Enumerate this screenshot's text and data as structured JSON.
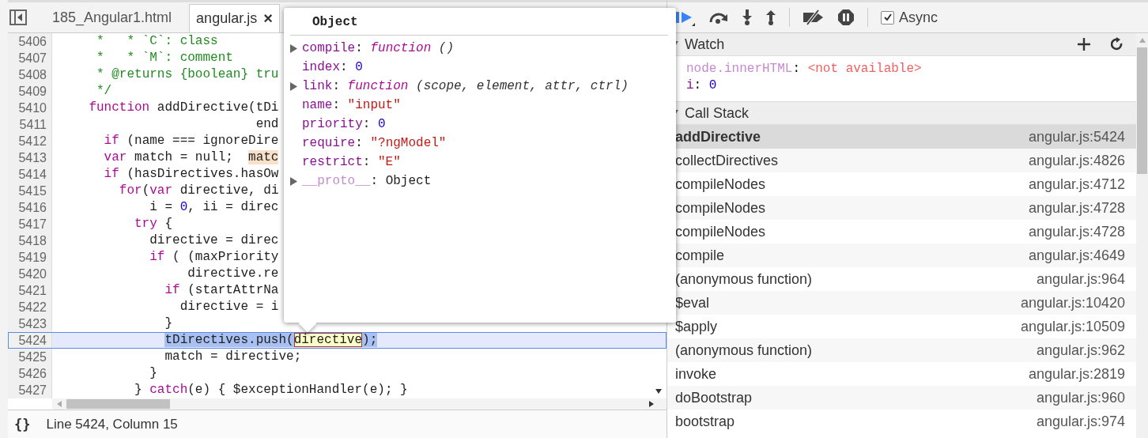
{
  "tabs": [
    {
      "label": "185_Angular1.html",
      "selected": false
    },
    {
      "label": "angular.js",
      "selected": true,
      "close": "×"
    }
  ],
  "code_lines": [
    {
      "number": "5406",
      "current": false,
      "segments": [
        {
          "kind": "comment",
          "text": "     *   * `C`: class"
        }
      ]
    },
    {
      "number": "5407",
      "current": false,
      "segments": [
        {
          "kind": "comment",
          "text": "     *   * `M`: comment"
        }
      ]
    },
    {
      "number": "5408",
      "current": false,
      "segments": [
        {
          "kind": "comment",
          "text": "     * @returns {boolean} tru"
        }
      ]
    },
    {
      "number": "5409",
      "current": false,
      "segments": [
        {
          "kind": "comment",
          "text": "     */"
        }
      ]
    },
    {
      "number": "5410",
      "current": false,
      "segments": [
        {
          "kind": "keyword",
          "text": "    function"
        },
        {
          "kind": "plain",
          "text": " addDirective(tDi"
        }
      ]
    },
    {
      "number": "5411",
      "current": false,
      "segments": [
        {
          "kind": "plain",
          "text": "                          end"
        }
      ]
    },
    {
      "number": "5412",
      "current": false,
      "segments": [
        {
          "kind": "keyword",
          "text": "      if"
        },
        {
          "kind": "plain",
          "text": " (name === ignoreDire"
        }
      ]
    },
    {
      "number": "5413",
      "current": false,
      "segments": [
        {
          "kind": "keyword",
          "text": "      var"
        },
        {
          "kind": "plain",
          "text": " match = null;  "
        },
        {
          "kind": "highlight",
          "text": "matc"
        }
      ]
    },
    {
      "number": "5414",
      "current": false,
      "segments": [
        {
          "kind": "keyword",
          "text": "      if"
        },
        {
          "kind": "plain",
          "text": " (hasDirectives.hasOw"
        }
      ]
    },
    {
      "number": "5415",
      "current": false,
      "segments": [
        {
          "kind": "keyword",
          "text": "        for"
        },
        {
          "kind": "plain",
          "text": "("
        },
        {
          "kind": "keyword",
          "text": "var"
        },
        {
          "kind": "plain",
          "text": " directive, di"
        }
      ]
    },
    {
      "number": "5416",
      "current": false,
      "segments": [
        {
          "kind": "plain",
          "text": "            i = "
        },
        {
          "kind": "number",
          "text": "0"
        },
        {
          "kind": "plain",
          "text": ", ii = direc"
        }
      ]
    },
    {
      "number": "5417",
      "current": false,
      "segments": [
        {
          "kind": "keyword",
          "text": "          try"
        },
        {
          "kind": "plain",
          "text": " {"
        }
      ]
    },
    {
      "number": "5418",
      "current": false,
      "segments": [
        {
          "kind": "plain",
          "text": "            directive = direc"
        }
      ]
    },
    {
      "number": "5419",
      "current": false,
      "segments": [
        {
          "kind": "keyword",
          "text": "            if"
        },
        {
          "kind": "plain",
          "text": " ( (maxPriority"
        }
      ]
    },
    {
      "number": "5420",
      "current": false,
      "segments": [
        {
          "kind": "plain",
          "text": "                 directive.re"
        }
      ]
    },
    {
      "number": "5421",
      "current": false,
      "segments": [
        {
          "kind": "keyword",
          "text": "              if"
        },
        {
          "kind": "plain",
          "text": " (startAttrNa"
        }
      ]
    },
    {
      "number": "5422",
      "current": false,
      "segments": [
        {
          "kind": "plain",
          "text": "                directive = i"
        }
      ]
    },
    {
      "number": "5423",
      "current": false,
      "segments": [
        {
          "kind": "plain",
          "text": "              }"
        }
      ]
    },
    {
      "number": "5424",
      "current": true,
      "segments": [
        {
          "kind": "selection",
          "text": "              tDirectives.push("
        },
        {
          "kind": "hover",
          "text": "directive"
        },
        {
          "kind": "selection",
          "text": ");"
        }
      ]
    },
    {
      "number": "5425",
      "current": false,
      "segments": [
        {
          "kind": "plain",
          "text": "              match = directive;"
        }
      ]
    },
    {
      "number": "5426",
      "current": false,
      "segments": [
        {
          "kind": "plain",
          "text": "            }"
        }
      ]
    },
    {
      "number": "5427",
      "current": false,
      "segments": [
        {
          "kind": "plain",
          "text": "          } "
        },
        {
          "kind": "keyword",
          "text": "catch"
        },
        {
          "kind": "plain",
          "text": "(e) { $exceptionHandler(e); }"
        }
      ]
    }
  ],
  "status_bar": {
    "format_button": "{}",
    "position": "Line 5424, Column 15"
  },
  "popover": {
    "title": "Object",
    "separator": ":",
    "properties": [
      {
        "name": "compile",
        "kind": "function",
        "keyword": "function",
        "params": "()",
        "expandable": true,
        "internal": false
      },
      {
        "name": "index",
        "kind": "number",
        "value": "0",
        "expandable": false,
        "internal": false
      },
      {
        "name": "link",
        "kind": "function",
        "keyword": "function",
        "params": "(scope, element, attr, ctrl)",
        "expandable": true,
        "internal": false
      },
      {
        "name": "name",
        "kind": "string",
        "value": "\"input\"",
        "expandable": false,
        "internal": false
      },
      {
        "name": "priority",
        "kind": "number",
        "value": "0",
        "expandable": false,
        "internal": false
      },
      {
        "name": "require",
        "kind": "string",
        "value": "\"?ngModel\"",
        "expandable": false,
        "internal": false
      },
      {
        "name": "restrict",
        "kind": "string",
        "value": "\"E\"",
        "expandable": false,
        "internal": false
      },
      {
        "name": "__proto__",
        "kind": "object",
        "value": "Object",
        "expandable": true,
        "internal": true
      }
    ]
  },
  "debugger_toolbar": {
    "buttons": [
      {
        "kind": "resume"
      },
      {
        "kind": "step-over"
      },
      {
        "kind": "step-into"
      },
      {
        "kind": "step-out"
      },
      {
        "kind": "deactivate-breakpoints"
      },
      {
        "kind": "pause-exceptions"
      }
    ],
    "async": {
      "label": "Async",
      "checked": true
    }
  },
  "watch": {
    "title": "Watch",
    "expanded": true,
    "separator": ":",
    "expressions": [
      {
        "name": "node.innerHTML",
        "kind": "error",
        "value": "<not available>"
      },
      {
        "name": "i",
        "kind": "number",
        "value": "0"
      }
    ]
  },
  "call_stack": {
    "title": "Call Stack",
    "expanded": true,
    "frames": [
      {
        "function": "addDirective",
        "location": "angular.js:5424",
        "selected": true
      },
      {
        "function": "collectDirectives",
        "location": "angular.js:4826",
        "selected": false
      },
      {
        "function": "compileNodes",
        "location": "angular.js:4712",
        "selected": false
      },
      {
        "function": "compileNodes",
        "location": "angular.js:4728",
        "selected": false
      },
      {
        "function": "compileNodes",
        "location": "angular.js:4728",
        "selected": false
      },
      {
        "function": "compile",
        "location": "angular.js:4649",
        "selected": false
      },
      {
        "function": "(anonymous function)",
        "location": "angular.js:964",
        "selected": false
      },
      {
        "function": "$eval",
        "location": "angular.js:10420",
        "selected": false
      },
      {
        "function": "$apply",
        "location": "angular.js:10509",
        "selected": false
      },
      {
        "function": "(anonymous function)",
        "location": "angular.js:962",
        "selected": false
      },
      {
        "function": "invoke",
        "location": "angular.js:2819",
        "selected": false
      },
      {
        "function": "doBootstrap",
        "location": "angular.js:960",
        "selected": false
      },
      {
        "function": "bootstrap",
        "location": "angular.js:974",
        "selected": false
      }
    ]
  }
}
